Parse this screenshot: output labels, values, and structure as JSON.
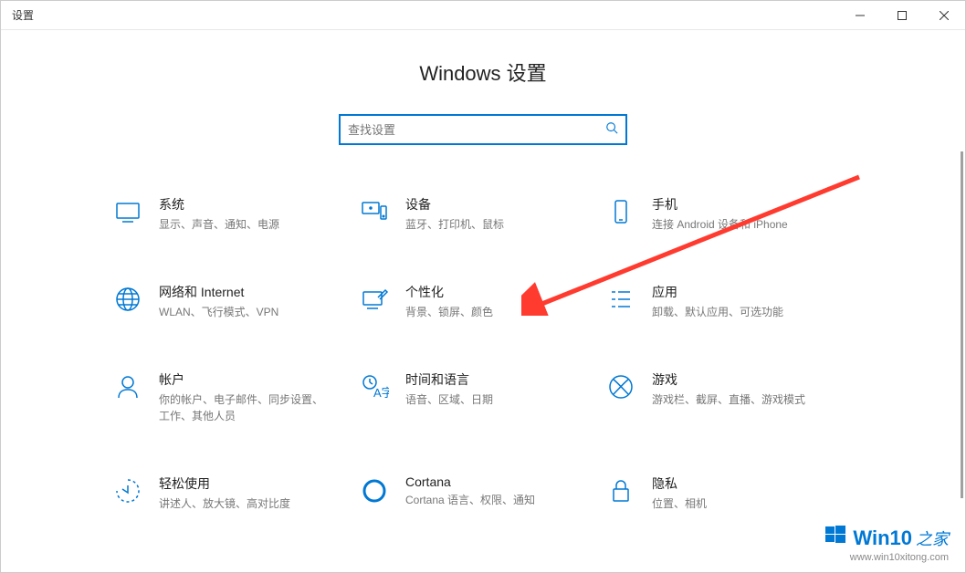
{
  "window": {
    "title": "设置"
  },
  "page": {
    "title": "Windows 设置",
    "search_placeholder": "查找设置"
  },
  "categories": [
    {
      "title": "系统",
      "desc": "显示、声音、通知、电源"
    },
    {
      "title": "设备",
      "desc": "蓝牙、打印机、鼠标"
    },
    {
      "title": "手机",
      "desc": "连接 Android 设备和 iPhone"
    },
    {
      "title": "网络和 Internet",
      "desc": "WLAN、飞行模式、VPN"
    },
    {
      "title": "个性化",
      "desc": "背景、锁屏、颜色"
    },
    {
      "title": "应用",
      "desc": "卸载、默认应用、可选功能"
    },
    {
      "title": "帐户",
      "desc": "你的帐户、电子邮件、同步设置、工作、其他人员"
    },
    {
      "title": "时间和语言",
      "desc": "语音、区域、日期"
    },
    {
      "title": "游戏",
      "desc": "游戏栏、截屏、直播、游戏模式"
    },
    {
      "title": "轻松使用",
      "desc": "讲述人、放大镜、高对比度"
    },
    {
      "title": "Cortana",
      "desc": "Cortana 语言、权限、通知"
    },
    {
      "title": "隐私",
      "desc": "位置、相机"
    }
  ],
  "watermark": {
    "brand1": "Win10",
    "brand2": "之家",
    "url": "www.win10xitong.com"
  },
  "accent_color": "#0078d4"
}
